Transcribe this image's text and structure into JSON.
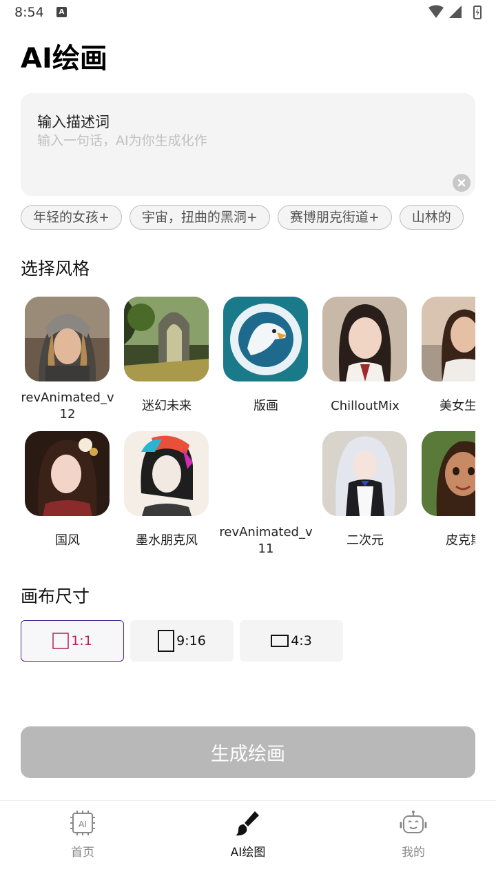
{
  "status_bar": {
    "time": "8:54",
    "notification_icon": "A"
  },
  "header": {
    "title": "AI绘画"
  },
  "prompt": {
    "label": "输入描述词",
    "placeholder": "输入一句话，AI为你生成化作",
    "value": ""
  },
  "suggestions": [
    "年轻的女孩+",
    "宇宙，扭曲的黑洞+",
    "赛博朋克街道+",
    "山林的"
  ],
  "style_section": {
    "title": "选择风格",
    "styles": [
      {
        "name": "revAnimated_v12",
        "line1": "revAnimated_v",
        "line2": "12"
      },
      {
        "name": "迷幻未来"
      },
      {
        "name": "版画"
      },
      {
        "name": "ChilloutMix"
      },
      {
        "name": "美女生成"
      },
      {
        "name": "国风"
      },
      {
        "name": "墨水朋克风"
      },
      {
        "name": "revAnimated_v11",
        "line1": "revAnimated_v",
        "line2": "11"
      },
      {
        "name": "二次元"
      },
      {
        "name": "皮克斯"
      }
    ]
  },
  "canvas_section": {
    "title": "画布尺寸",
    "options": [
      {
        "label": "1:1",
        "selected": true
      },
      {
        "label": "9:16",
        "selected": false
      },
      {
        "label": "4:3",
        "selected": false
      }
    ]
  },
  "generate_button": {
    "label": "生成绘画"
  },
  "bottom_nav": {
    "items": [
      {
        "label": "首页",
        "icon": "ai-chip-icon",
        "active": false
      },
      {
        "label": "AI绘图",
        "icon": "paintbrush-icon",
        "active": true
      },
      {
        "label": "我的",
        "icon": "robot-face-icon",
        "active": false
      }
    ]
  },
  "colors": {
    "accent_border": "#4a2a8a",
    "selected_ratio": "#b0245a",
    "button_disabled": "#b8b8b8"
  }
}
